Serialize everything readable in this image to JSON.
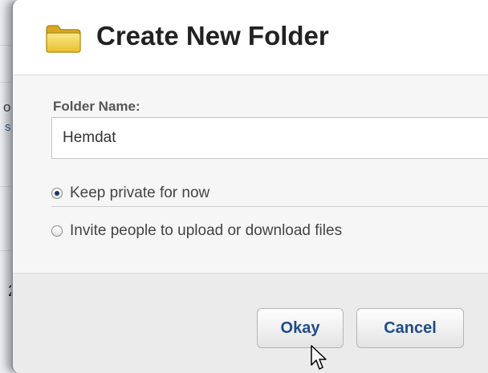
{
  "background": {
    "fragments": [
      "or",
      "s",
      "2"
    ]
  },
  "dialog": {
    "title": "Create New Folder",
    "title_icon": "folder-icon",
    "folder_name": {
      "label": "Folder Name:",
      "value": "Hemdat"
    },
    "visibility_options": [
      {
        "label": "Keep private for now",
        "selected": true
      },
      {
        "label": "Invite people to upload or download files",
        "selected": false
      }
    ],
    "buttons": {
      "okay": "Okay",
      "cancel": "Cancel"
    }
  },
  "colors": {
    "button_text": "#1f4c8a",
    "folder_yellow": "#f2d24a"
  }
}
